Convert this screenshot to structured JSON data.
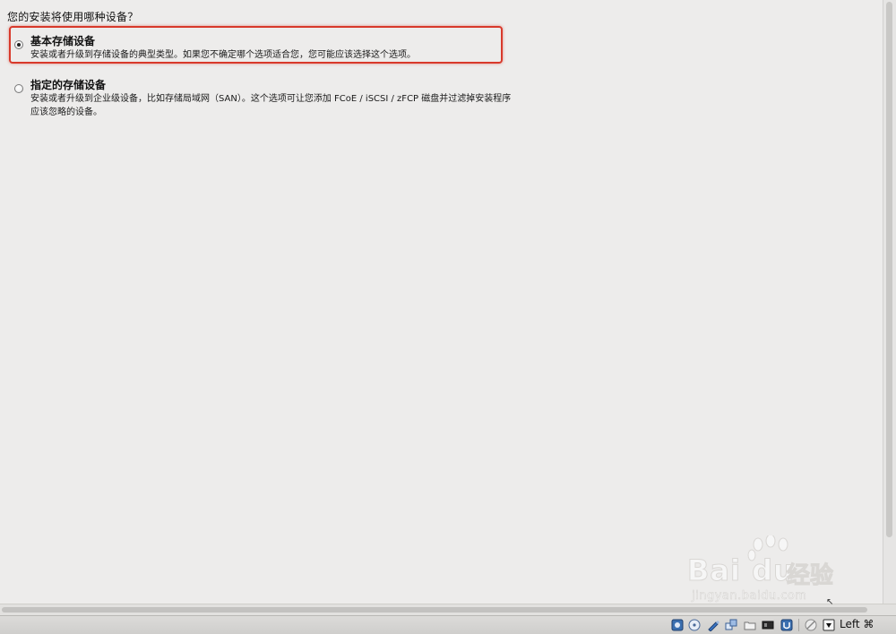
{
  "question": "您的安装将使用哪种设备？",
  "options": [
    {
      "title": "基本存储设备",
      "description_lines": [
        "安装或者升级到存储设备的典型类型。如果您不确定哪个选项适合您，您可能应该选择这个选项。"
      ],
      "selected": true,
      "highlighted": true
    },
    {
      "title": "指定的存储设备",
      "description_lines": [
        "安装或者升级到企业级设备，比如存储局域网（SAN）。这个选项可让您添加 FCoE / iSCSI / zFCP 磁盘并过滤掉安装程序",
        "应该忽略的设备。"
      ],
      "selected": false,
      "highlighted": false
    }
  ],
  "statusbar": {
    "icons": [
      "hard-disk-icon",
      "optical-disc-icon",
      "usb-pen-icon",
      "network-icon",
      "shared-folder-icon",
      "display-icon",
      "usb-icon",
      "capture-icon",
      "mouse-integration-icon",
      "arrow-down-icon"
    ],
    "host_key_label": "Left ⌘"
  },
  "watermark": {
    "brand": "Bai du",
    "brand_cn": "经验",
    "url": "jingyan.baidu.com"
  },
  "colors": {
    "background": "#edeceb",
    "highlight": "#d8392b"
  }
}
